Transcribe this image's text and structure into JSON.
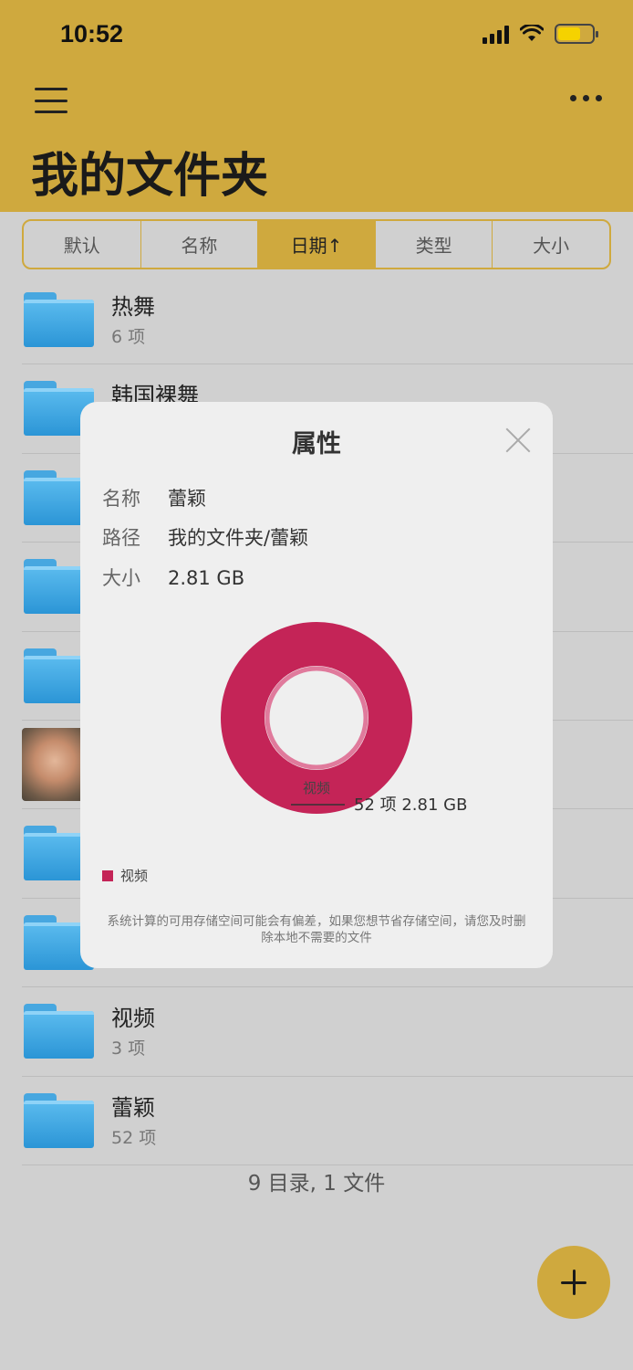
{
  "status_bar": {
    "time": "10:52"
  },
  "header": {
    "title": "我的文件夹"
  },
  "sort_tabs": [
    {
      "label": "默认",
      "active": false
    },
    {
      "label": "名称",
      "active": false
    },
    {
      "label": "日期↑",
      "active": true
    },
    {
      "label": "类型",
      "active": false
    },
    {
      "label": "大小",
      "active": false
    }
  ],
  "list": [
    {
      "name": "热舞",
      "count": "6 项",
      "kind": "folder"
    },
    {
      "name": "韩国裸舞",
      "count": "",
      "kind": "folder"
    },
    {
      "name": "",
      "count": "",
      "kind": "folder"
    },
    {
      "name": "",
      "count": "",
      "kind": "folder"
    },
    {
      "name": "",
      "count": "",
      "kind": "folder"
    },
    {
      "name": "",
      "count": "",
      "kind": "image"
    },
    {
      "name": "",
      "count": "",
      "kind": "folder"
    },
    {
      "name": "",
      "count": "",
      "kind": "folder"
    },
    {
      "name": "视频",
      "count": "3 项",
      "kind": "folder"
    },
    {
      "name": "蕾颖",
      "count": "52 项",
      "kind": "folder"
    }
  ],
  "summary": "9 目录, 1 文件",
  "dialog": {
    "title": "属性",
    "properties": [
      {
        "label": "名称",
        "value": "蕾颖"
      },
      {
        "label": "路径",
        "value": "我的文件夹/蕾颖"
      },
      {
        "label": "大小",
        "value": "2.81 GB"
      }
    ],
    "footnote": "系统计算的可用存储空间可能会有偏差，如果您想节省存储空间，请您及时删除本地不需要的文件"
  },
  "chart_data": {
    "type": "pie",
    "categories": [
      "视频"
    ],
    "values": [
      100
    ],
    "slice_labels": [
      {
        "category": "视频",
        "annotation": "52 项 2.81 GB"
      }
    ],
    "legend": [
      "视频"
    ],
    "legend_position": "bottom-left",
    "colors": [
      "#c42457"
    ]
  },
  "colors": {
    "accent": "#cfa93e",
    "chart": "#c42457"
  }
}
